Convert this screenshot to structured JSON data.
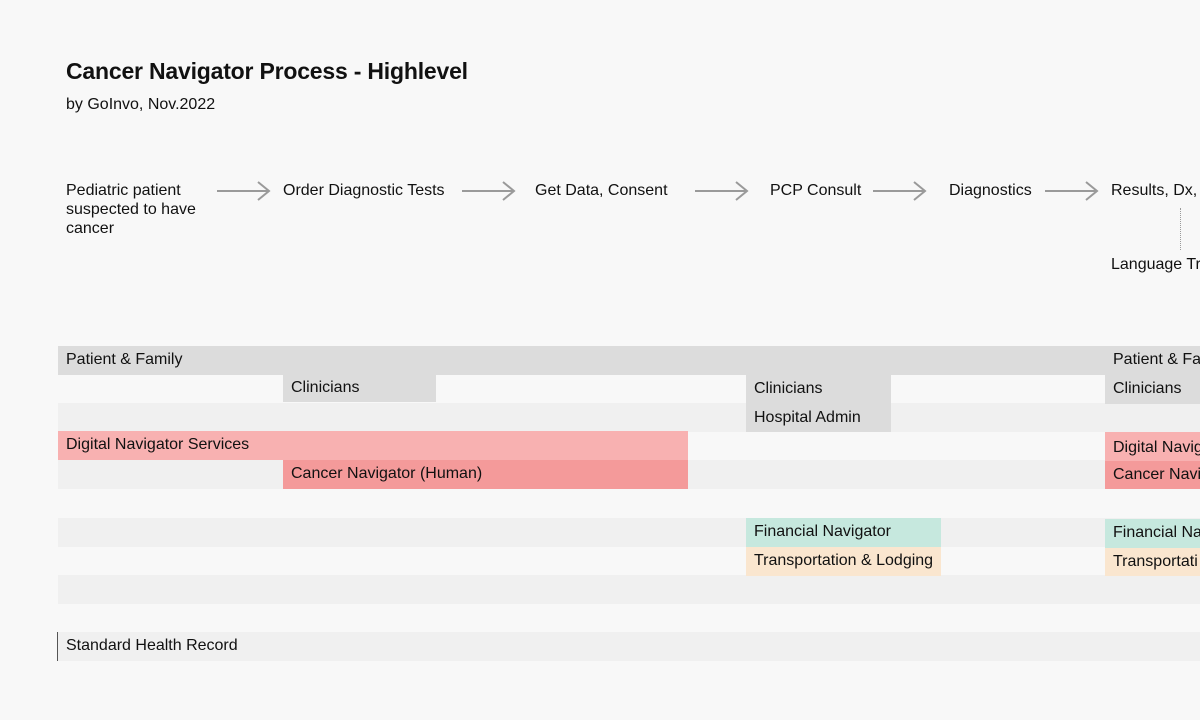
{
  "header": {
    "title": "Cancer Navigator Process - Highlevel",
    "subtitle": "by GoInvo, Nov.2022"
  },
  "flow": {
    "steps": [
      "Pediatric patient suspected to have cancer",
      "Order Diagnostic Tests",
      "Get Data, Consent",
      "PCP Consult",
      "Diagnostics",
      "Results, Dx,"
    ],
    "note": "Language Tr"
  },
  "lanes": {
    "patient_family": "Patient & Family",
    "patient_family_right": "Patient & Fa",
    "clinicians": "Clinicians",
    "hospital_admin": "Hospital Admin",
    "digital_navigator": "Digital Navigator Services",
    "digital_navigator_right": "Digital Navig",
    "cancer_navigator": "Cancer Navigator (Human)",
    "cancer_navigator_right": "Cancer Navi",
    "financial_navigator": "Financial Navigator",
    "financial_navigator_right": "Financial Na",
    "transportation": "Transportation & Lodging",
    "transportation_right": "Transportati",
    "health_record": "Standard Health Record"
  },
  "colors": {
    "background": "#f8f8f8",
    "lane_band": "#f0f0f0",
    "gray_block": "#dcdcdc",
    "digital_navigator": "#f8b1b1",
    "cancer_navigator": "#f49a9a",
    "financial_navigator": "#c6e8de",
    "transportation": "#fae6cf",
    "arrow": "#9a9a9a"
  }
}
